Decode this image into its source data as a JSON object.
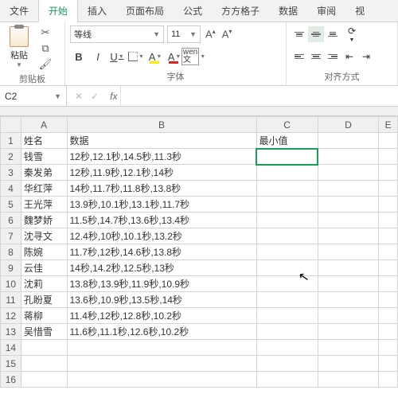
{
  "tabs": [
    "文件",
    "开始",
    "插入",
    "页面布局",
    "公式",
    "方方格子",
    "数据",
    "审阅",
    "视"
  ],
  "activeTab": 1,
  "ribbon": {
    "pasteLabel": "粘贴",
    "clipboardLabel": "剪贴板",
    "fontName": "等线",
    "fontSize": "11",
    "fontLabel": "字体",
    "alignLabel": "对齐方式",
    "bold": "B",
    "italic": "I",
    "under": "U",
    "strike": "A",
    "wen": "wen 文"
  },
  "nameBox": "C2",
  "formulaBar": "",
  "headersCol": [
    "A",
    "B",
    "C",
    "D",
    "E"
  ],
  "rows": [
    {
      "n": "1",
      "a": "姓名",
      "b": "数据",
      "c": "最小值"
    },
    {
      "n": "2",
      "a": "钱雪",
      "b": "12秒,12.1秒,14.5秒,11.3秒",
      "c": ""
    },
    {
      "n": "3",
      "a": "秦发弟",
      "b": "12秒,11.9秒,12.1秒,14秒",
      "c": ""
    },
    {
      "n": "4",
      "a": "华红萍",
      "b": "14秒,11.7秒,11.8秒,13.8秒",
      "c": ""
    },
    {
      "n": "5",
      "a": "王光萍",
      "b": "13.9秒,10.1秒,13.1秒,11.7秒",
      "c": ""
    },
    {
      "n": "6",
      "a": "魏梦娇",
      "b": "11.5秒,14.7秒,13.6秒,13.4秒",
      "c": ""
    },
    {
      "n": "7",
      "a": "沈寻文",
      "b": "12.4秒,10秒,10.1秒,13.2秒",
      "c": ""
    },
    {
      "n": "8",
      "a": "陈婉",
      "b": "11.7秒,12秒,14.6秒,13.8秒",
      "c": ""
    },
    {
      "n": "9",
      "a": "云佳",
      "b": "14秒,14.2秒,12.5秒,13秒",
      "c": ""
    },
    {
      "n": "10",
      "a": "沈莉",
      "b": "13.8秒,13.9秒,11.9秒,10.9秒",
      "c": ""
    },
    {
      "n": "11",
      "a": "孔盼夏",
      "b": "13.6秒,10.9秒,13.5秒,14秒",
      "c": ""
    },
    {
      "n": "12",
      "a": "蒋柳",
      "b": "11.4秒,12秒,12.8秒,10.2秒",
      "c": ""
    },
    {
      "n": "13",
      "a": "吴惜雪",
      "b": "11.6秒,11.1秒,12.6秒,10.2秒",
      "c": ""
    },
    {
      "n": "14",
      "a": "",
      "b": "",
      "c": ""
    },
    {
      "n": "15",
      "a": "",
      "b": "",
      "c": ""
    },
    {
      "n": "16",
      "a": "",
      "b": "",
      "c": ""
    }
  ],
  "selectedCell": {
    "row": 2,
    "col": "C"
  }
}
